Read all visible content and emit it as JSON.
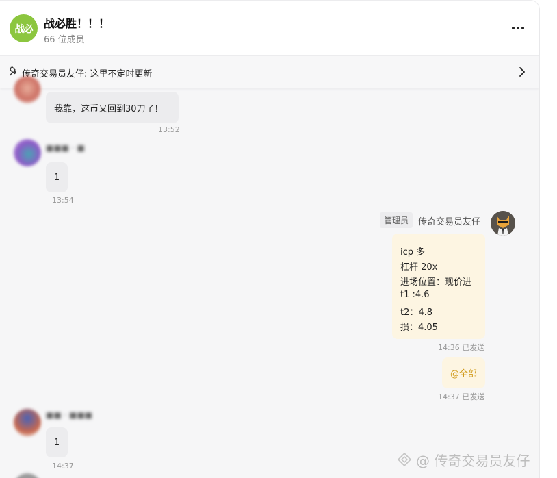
{
  "header": {
    "avatar_text": "战必",
    "title": "战必胜！！！",
    "member_count": "66 位成员"
  },
  "pinned": {
    "text": "传奇交易员友仔: 这里不定时更新"
  },
  "messages": [
    {
      "text": "我靠，这币又回到30刀了！",
      "time": "13:52"
    },
    {
      "text": "1",
      "time": "13:54"
    },
    {
      "text": "1",
      "time": "14:37"
    }
  ],
  "admin": {
    "badge": "管理员",
    "name": "传奇交易员友仔",
    "post_lines": [
      "icp  多",
      "杠杆 20x",
      "进场位置：现价进",
      "t1 :4.6",
      "t2：4.8",
      "损：4.05"
    ],
    "post_time": "14:36",
    "post_status": "已发送",
    "mention": "@全部",
    "mention_time": "14:37",
    "mention_status": "已发送"
  },
  "watermark": {
    "text": "@ 传奇交易员友仔"
  },
  "colors": {
    "group_avatar": "#8cc63f",
    "own_bubble": "#fdf5e2",
    "other_bubble": "#ececee",
    "mention": "#d09a1a"
  }
}
